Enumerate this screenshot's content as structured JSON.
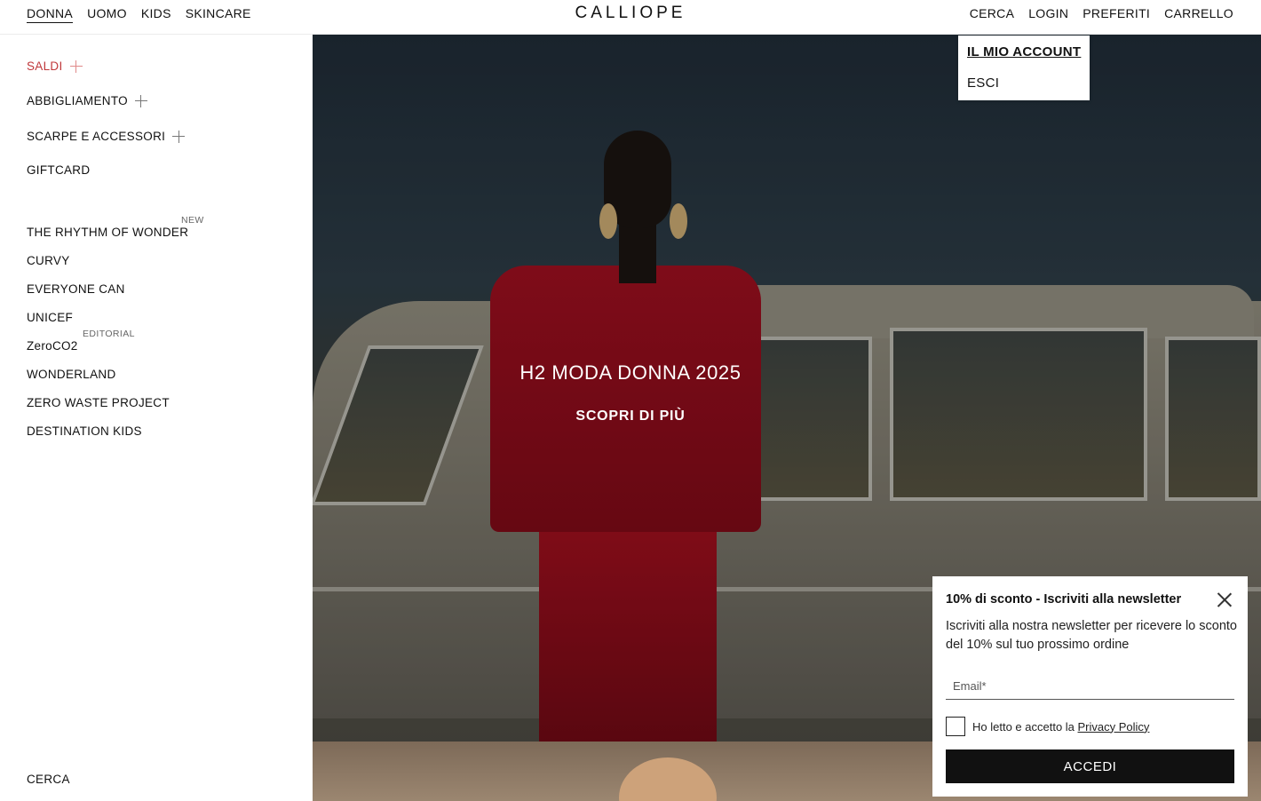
{
  "header": {
    "brand": "CALLIOPE",
    "gender_tabs": [
      {
        "label": "DONNA",
        "active": true
      },
      {
        "label": "UOMO"
      },
      {
        "label": "KIDS"
      },
      {
        "label": "SKINCARE"
      }
    ],
    "utility": {
      "search": "CERCA",
      "login": "LOGIN",
      "favorites": "PREFERITI",
      "cart": "CARRELLO"
    }
  },
  "account_menu": {
    "my_account": "IL MIO ACCOUNT",
    "logout": "ESCI"
  },
  "sidebar": {
    "sale": "SALDI",
    "clothing": "ABBIGLIAMENTO",
    "shoes_accessories": "SCARPE E ACCESSORI",
    "giftcard": "GIFTCARD",
    "collections": [
      {
        "label": "THE RHYTHM OF WONDER",
        "tag": "NEW"
      },
      {
        "label": "CURVY"
      },
      {
        "label": "EVERYONE CAN"
      },
      {
        "label": "UNICEF"
      },
      {
        "label": "ZeroCO2",
        "tag": "EDITORIAL"
      },
      {
        "label": "WONDERLAND"
      },
      {
        "label": "ZERO WASTE PROJECT"
      },
      {
        "label": "DESTINATION KIDS"
      }
    ],
    "search": "CERCA"
  },
  "hero": {
    "title": "H2 MODA DONNA 2025",
    "cta": "SCOPRI DI PIÙ"
  },
  "newsletter": {
    "title": "10% di sconto - Iscriviti alla newsletter",
    "text": "Iscriviti alla nostra newsletter per ricevere lo sconto del 10% sul tuo prossimo ordine",
    "email_placeholder": "Email*",
    "consent_prefix": "Ho letto e accetto la ",
    "consent_link": "Privacy Policy",
    "submit": "ACCEDI"
  },
  "colors": {
    "sale_red": "#c0383b",
    "jacket_red": "#9b0f1f",
    "button_black": "#111111"
  }
}
